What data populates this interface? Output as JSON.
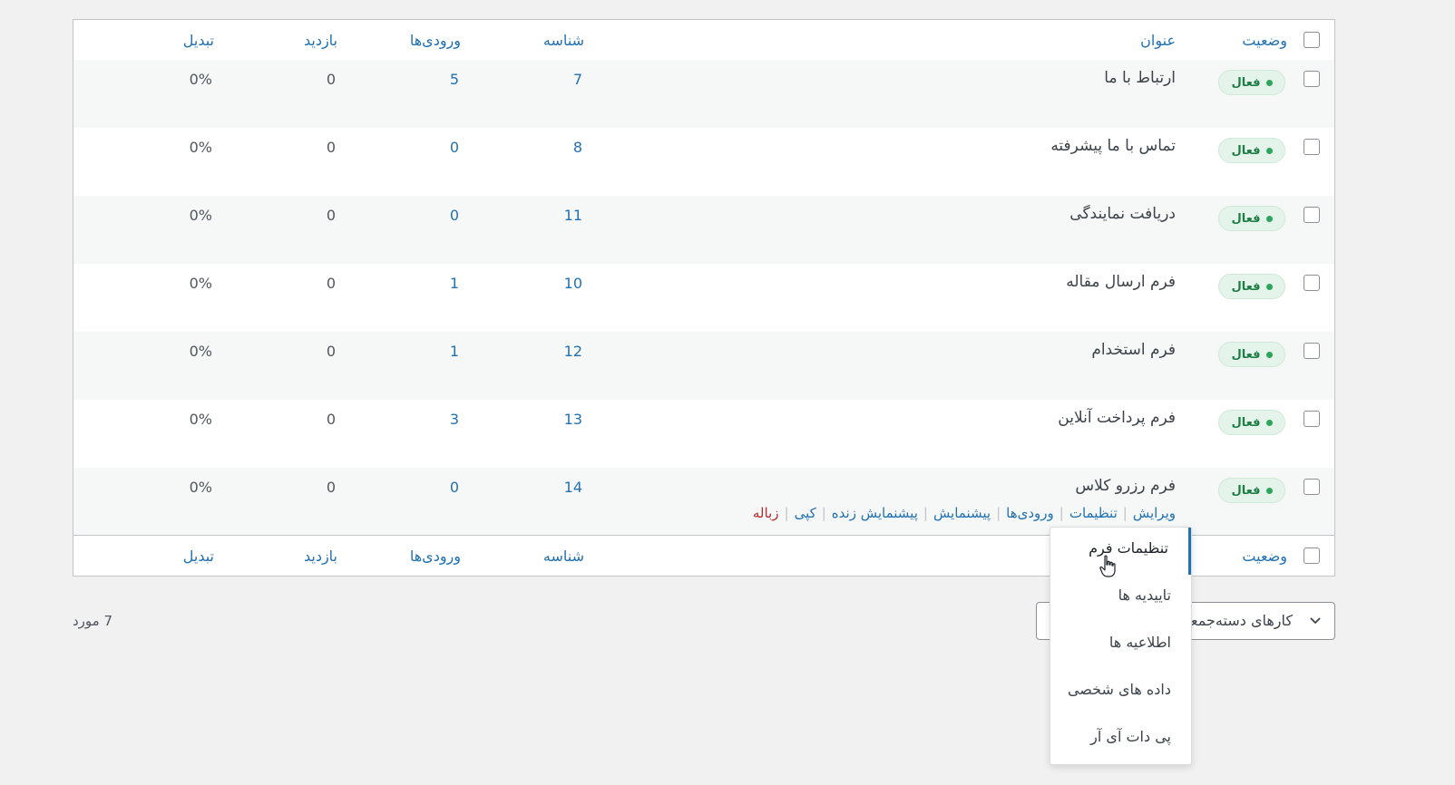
{
  "columns": {
    "status": "وضعیت",
    "title": "عنوان",
    "id": "شناسه",
    "entries": "ورودی‌ها",
    "views": "بازدید",
    "conversion": "تبدیل"
  },
  "status_label": "فعال",
  "rows": [
    {
      "title": "ارتباط با ما",
      "id": "7",
      "entries": "5",
      "views": "0",
      "conversion": "0%"
    },
    {
      "title": "تماس با ما پیشرفته",
      "id": "8",
      "entries": "0",
      "views": "0",
      "conversion": "0%"
    },
    {
      "title": "دریافت نمایندگی",
      "id": "11",
      "entries": "0",
      "views": "0",
      "conversion": "0%"
    },
    {
      "title": "فرم ارسال مقاله",
      "id": "10",
      "entries": "1",
      "views": "0",
      "conversion": "0%"
    },
    {
      "title": "فرم استخدام",
      "id": "12",
      "entries": "1",
      "views": "0",
      "conversion": "0%"
    },
    {
      "title": "فرم پرداخت آنلاین",
      "id": "13",
      "entries": "3",
      "views": "0",
      "conversion": "0%"
    },
    {
      "title": "فرم رزرو کلاس",
      "id": "14",
      "entries": "0",
      "views": "0",
      "conversion": "0%"
    }
  ],
  "row_actions": {
    "edit": "ویرایش",
    "settings": "تنظیمات",
    "entries": "ورودی‌ها",
    "preview": "پیشنمایش",
    "live_preview": "پیشنمایش زنده",
    "copy": "کپی",
    "trash": "زباله"
  },
  "settings_menu": {
    "items": [
      "تنظیمات فرم",
      "تاییدیه ها",
      "اطلاعیه ها",
      "داده های شخصی",
      "پی دات آی آر"
    ]
  },
  "bulk_actions": {
    "label": "کارهای دسته‌جمعی"
  },
  "item_count": "7 مورد",
  "colors": {
    "link": "#2271b1",
    "badge_bg": "#e5f4eb",
    "badge_text": "#1e7d45",
    "trash": "#b32d2e"
  }
}
